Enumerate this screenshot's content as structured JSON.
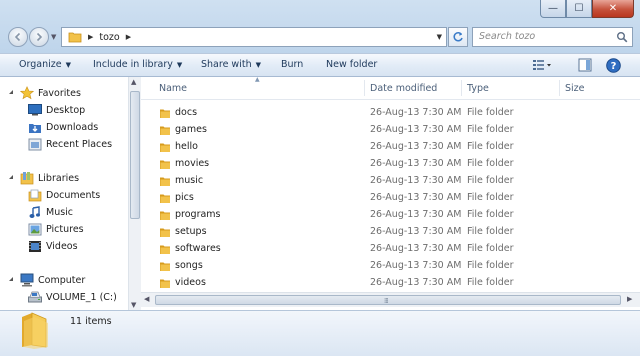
{
  "window": {
    "minimize_glyph": "—",
    "maximize_glyph": "☐",
    "close_glyph": "✕"
  },
  "address": {
    "path": [
      "tozo"
    ]
  },
  "search": {
    "placeholder": "Search tozo"
  },
  "toolbar": {
    "organize": "Organize",
    "include_in_library": "Include in library",
    "share_with": "Share with",
    "burn": "Burn",
    "new_folder": "New folder"
  },
  "sidebar": {
    "groups": [
      {
        "label": "Favorites",
        "icon": "star-icon",
        "items": [
          {
            "label": "Desktop",
            "icon": "desktop-icon"
          },
          {
            "label": "Downloads",
            "icon": "downloads-icon"
          },
          {
            "label": "Recent Places",
            "icon": "recent-places-icon"
          }
        ]
      },
      {
        "label": "Libraries",
        "icon": "libraries-icon",
        "items": [
          {
            "label": "Documents",
            "icon": "documents-icon"
          },
          {
            "label": "Music",
            "icon": "music-icon"
          },
          {
            "label": "Pictures",
            "icon": "pictures-icon"
          },
          {
            "label": "Videos",
            "icon": "videos-icon"
          }
        ]
      },
      {
        "label": "Computer",
        "icon": "computer-icon",
        "items": [
          {
            "label": "VOLUME_1 (C:)",
            "icon": "drive-icon"
          }
        ]
      }
    ]
  },
  "columns": [
    "Name",
    "Date modified",
    "Type",
    "Size"
  ],
  "files": [
    {
      "name": "docs",
      "date": "26-Aug-13 7:30 AM",
      "type": "File folder",
      "size": ""
    },
    {
      "name": "games",
      "date": "26-Aug-13 7:30 AM",
      "type": "File folder",
      "size": ""
    },
    {
      "name": "hello",
      "date": "26-Aug-13 7:30 AM",
      "type": "File folder",
      "size": ""
    },
    {
      "name": "movies",
      "date": "26-Aug-13 7:30 AM",
      "type": "File folder",
      "size": ""
    },
    {
      "name": "music",
      "date": "26-Aug-13 7:30 AM",
      "type": "File folder",
      "size": ""
    },
    {
      "name": "pics",
      "date": "26-Aug-13 7:30 AM",
      "type": "File folder",
      "size": ""
    },
    {
      "name": "programs",
      "date": "26-Aug-13 7:30 AM",
      "type": "File folder",
      "size": ""
    },
    {
      "name": "setups",
      "date": "26-Aug-13 7:30 AM",
      "type": "File folder",
      "size": ""
    },
    {
      "name": "softwares",
      "date": "26-Aug-13 7:30 AM",
      "type": "File folder",
      "size": ""
    },
    {
      "name": "songs",
      "date": "26-Aug-13 7:30 AM",
      "type": "File folder",
      "size": ""
    },
    {
      "name": "videos",
      "date": "26-Aug-13 7:30 AM",
      "type": "File folder",
      "size": ""
    }
  ],
  "details": {
    "item_count": "11 items"
  },
  "colors": {
    "folder": "#f2c24a",
    "folder_dark": "#d79b1c",
    "toolbar_text": "#1e395b",
    "header_text": "#4c607a",
    "dim_text": "#6d6d6d"
  }
}
